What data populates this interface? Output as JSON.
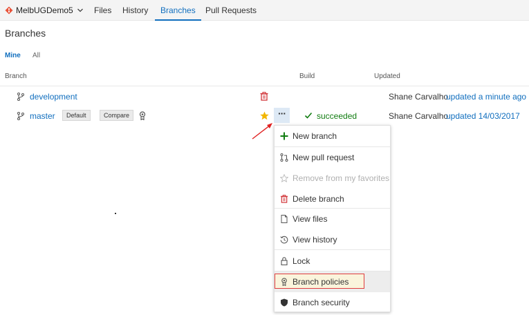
{
  "nav": {
    "repo_name": "MelbUGDemo5",
    "tabs": [
      {
        "label": "Files",
        "active": false
      },
      {
        "label": "History",
        "active": false
      },
      {
        "label": "Branches",
        "active": true
      },
      {
        "label": "Pull Requests",
        "active": false
      }
    ]
  },
  "page_title": "Branches",
  "pivots": {
    "mine": "Mine",
    "all": "All",
    "selected": "Mine"
  },
  "columns": {
    "branch": "Branch",
    "build": "Build",
    "updated": "Updated"
  },
  "branches": [
    {
      "name": "development",
      "updated_by": "Shane Carvalho",
      "updated_when": "updated a minute ago",
      "action_icon": "trash-icon"
    },
    {
      "name": "master",
      "tags": [
        "Default",
        "Compare"
      ],
      "favorite": true,
      "build_status": "succeeded",
      "updated_by": "Shane Carvalho",
      "updated_when": "updated 14/03/2017"
    }
  ],
  "context_menu": {
    "items": [
      {
        "label": "New branch",
        "icon": "plus-icon",
        "enabled": true
      },
      {
        "label": "New pull request",
        "icon": "pull-request-icon",
        "enabled": true
      },
      {
        "label": "Remove from my favorites",
        "icon": "star-outline-icon",
        "enabled": false
      },
      {
        "label": "Delete branch",
        "icon": "trash-icon",
        "enabled": true
      },
      {
        "label": "View files",
        "icon": "file-icon",
        "enabled": true
      },
      {
        "label": "View history",
        "icon": "history-icon",
        "enabled": true
      },
      {
        "label": "Lock",
        "icon": "lock-icon",
        "enabled": true
      },
      {
        "label": "Branch policies",
        "icon": "policy-icon",
        "enabled": true,
        "highlighted": true
      },
      {
        "label": "Branch security",
        "icon": "shield-icon",
        "enabled": true
      }
    ]
  },
  "colors": {
    "accent": "#106ebe",
    "success": "#107c10",
    "danger": "#d13438",
    "favorite": "#f2b600",
    "highlight_border": "#e03c3c",
    "repo_icon": "#e8533a"
  }
}
